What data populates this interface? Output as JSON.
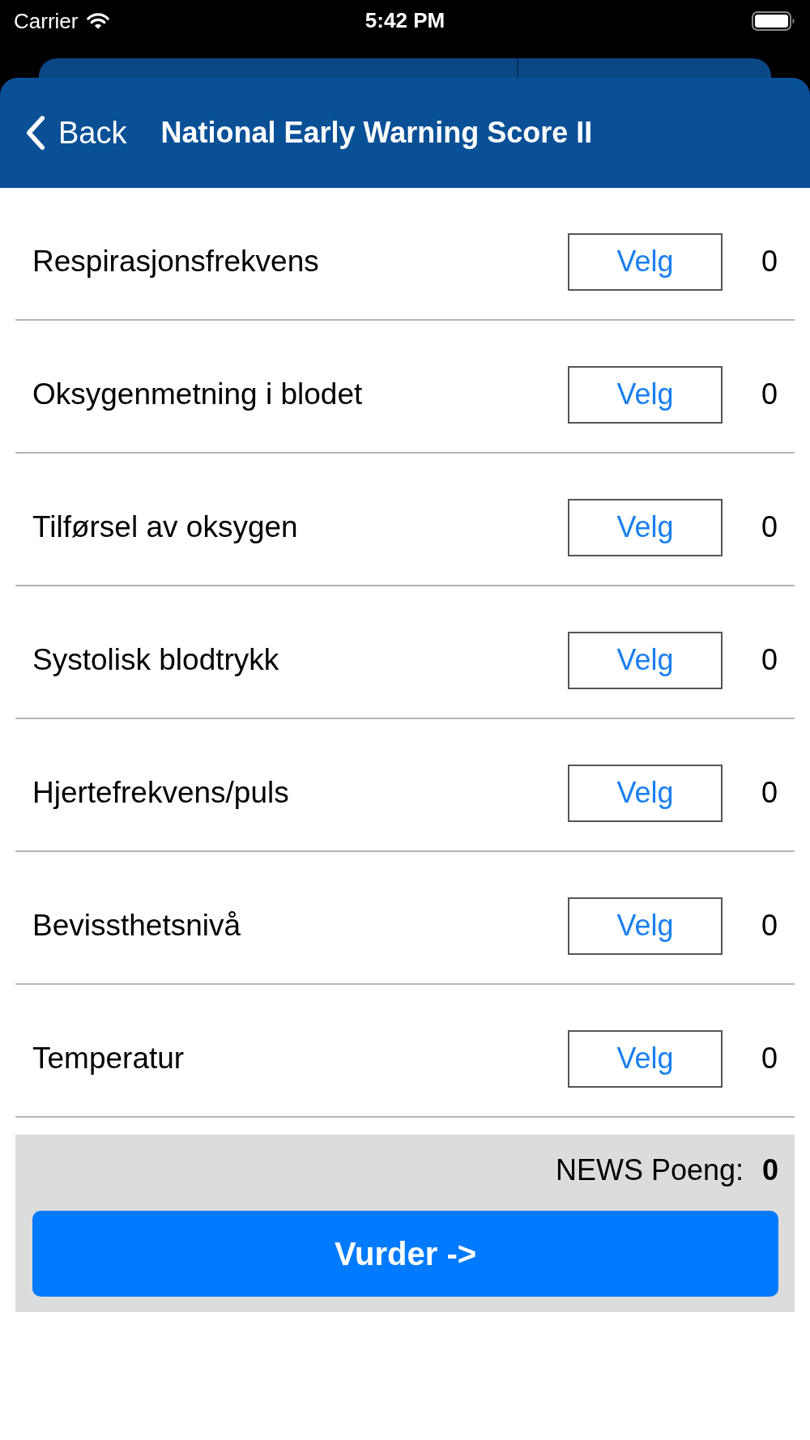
{
  "status_bar": {
    "carrier": "Carrier",
    "time": "5:42 PM"
  },
  "nav": {
    "back": "Back",
    "title": "National Early Warning Score II"
  },
  "parameters": [
    {
      "label": "Respirasjonsfrekvens",
      "button": "Velg",
      "score": "0"
    },
    {
      "label": "Oksygenmetning i blodet",
      "button": "Velg",
      "score": "0"
    },
    {
      "label": "Tilførsel av oksygen",
      "button": "Velg",
      "score": "0"
    },
    {
      "label": "Systolisk blodtrykk",
      "button": "Velg",
      "score": "0"
    },
    {
      "label": "Hjertefrekvens/puls",
      "button": "Velg",
      "score": "0"
    },
    {
      "label": "Bevissthetsnivå",
      "button": "Velg",
      "score": "0"
    },
    {
      "label": "Temperatur",
      "button": "Velg",
      "score": "0"
    }
  ],
  "summary": {
    "label": "NEWS Poeng:",
    "score": "0"
  },
  "primary_button": "Vurder ->"
}
